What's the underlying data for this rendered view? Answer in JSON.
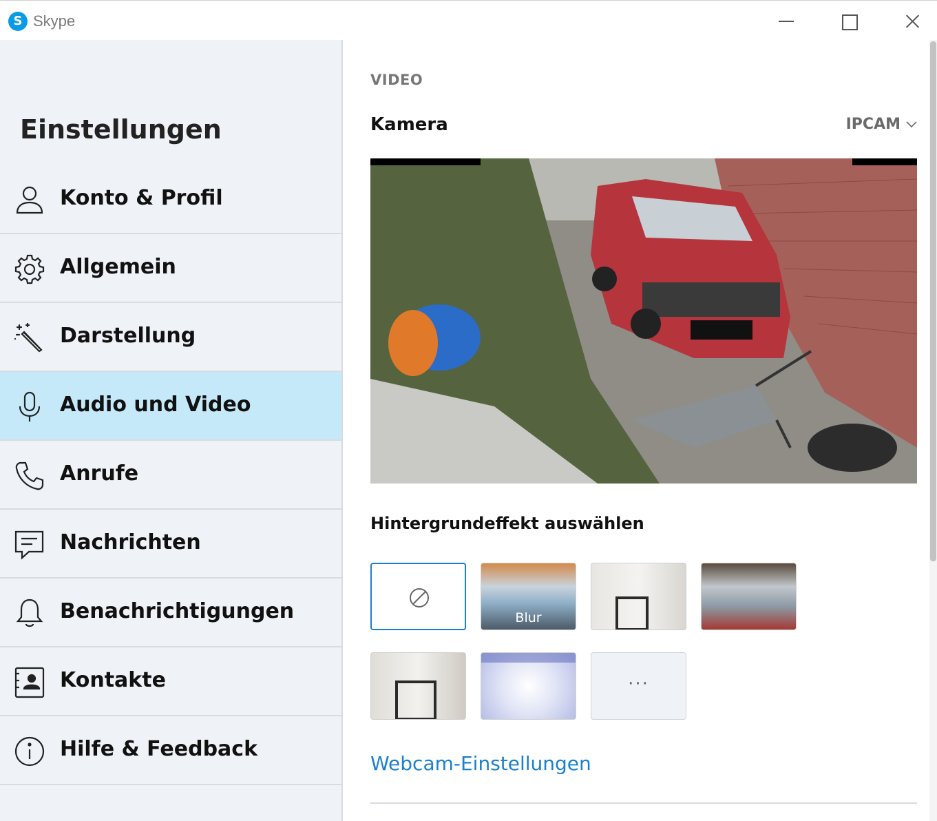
{
  "window": {
    "app_title": "Skype",
    "logo_letter": "S"
  },
  "sidebar": {
    "title": "Einstellungen",
    "items": [
      {
        "label": "Konto & Profil",
        "icon": "person-icon",
        "active": false
      },
      {
        "label": "Allgemein",
        "icon": "gear-icon",
        "active": false
      },
      {
        "label": "Darstellung",
        "icon": "magic-wand-icon",
        "active": false
      },
      {
        "label": "Audio und Video",
        "icon": "microphone-icon",
        "active": true
      },
      {
        "label": "Anrufe",
        "icon": "phone-icon",
        "active": false
      },
      {
        "label": "Nachrichten",
        "icon": "message-icon",
        "active": false
      },
      {
        "label": "Benachrichtigungen",
        "icon": "bell-icon",
        "active": false
      },
      {
        "label": "Kontakte",
        "icon": "contact-card-icon",
        "active": false
      },
      {
        "label": "Hilfe & Feedback",
        "icon": "info-icon",
        "active": false
      }
    ]
  },
  "main": {
    "section_title": "VIDEO",
    "camera_label": "Kamera",
    "camera_value": "IPCAM",
    "background_title": "Hintergrundeffekt auswählen",
    "effects": [
      {
        "name": "none",
        "label": "",
        "selected": true
      },
      {
        "name": "blur",
        "label": "Blur",
        "selected": false
      },
      {
        "name": "room-1",
        "label": "",
        "selected": false
      },
      {
        "name": "office",
        "label": "",
        "selected": false
      },
      {
        "name": "room-2",
        "label": "",
        "selected": false
      },
      {
        "name": "pattern",
        "label": "",
        "selected": false
      },
      {
        "name": "more",
        "label": "···",
        "selected": false
      }
    ],
    "webcam_link": "Webcam-Einstellungen"
  },
  "colors": {
    "accent": "#1a7fce",
    "active_nav": "#c5e9f9",
    "sidebar_bg": "#eff2f6",
    "skype_blue": "#0a9be5"
  }
}
